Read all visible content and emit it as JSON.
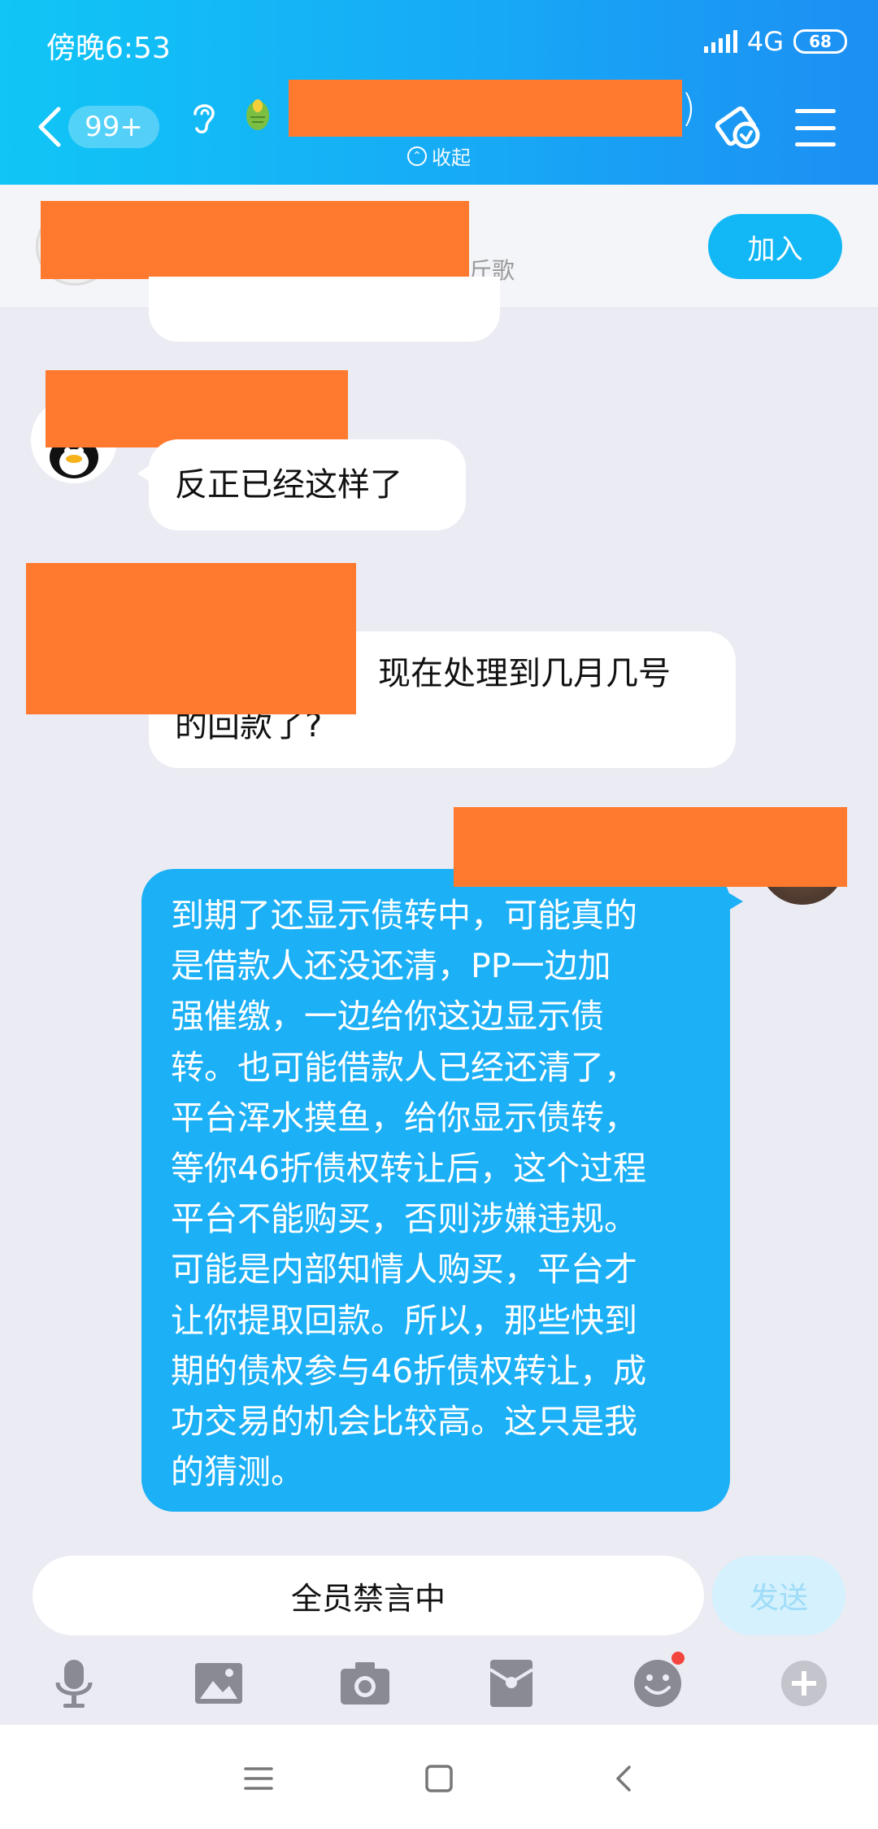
{
  "status_bar": {
    "time": "傍晚6:53",
    "network": "4G",
    "battery": "68"
  },
  "header": {
    "unread_count": "99+",
    "title_suffix": ")",
    "collapse_label": "收起"
  },
  "join_banner": {
    "visible_text_tail": "斤歌",
    "join_label": "加入"
  },
  "messages": {
    "incoming_1": "反正已经这样了",
    "incoming_2_line1": "现在处理到几月几号",
    "incoming_2_line2": "的回款了?",
    "outgoing_1": [
      "到期了还显示债转中，可能真的",
      "是借款人还没还清，PP一边加",
      "强催缴，一边给你这边显示债",
      "转。也可能借款人已经还清了，",
      "平台浑水摸鱼，给你显示债转，",
      "等你46折债权转让后，这个过程",
      "平台不能购买，否则涉嫌违规。",
      "可能是内部知情人购买，平台才",
      "让你提取回款。所以，那些快到",
      "期的债权参与46折债权转让，成",
      "功交易的机会比较高。这只是我",
      "的猜测。"
    ]
  },
  "input": {
    "placeholder": "全员禁言中",
    "send_label": "发送"
  },
  "toolbar": [
    "microphone-icon",
    "image-icon",
    "camera-icon",
    "red-packet-icon",
    "emoji-icon",
    "plus-icon"
  ],
  "colors": {
    "header_start": "#10c6f6",
    "header_end": "#1c8ff3",
    "outgoing_bubble": "#1cb0f6",
    "redaction": "#ff7a2e",
    "join_button": "#12b7f5"
  }
}
